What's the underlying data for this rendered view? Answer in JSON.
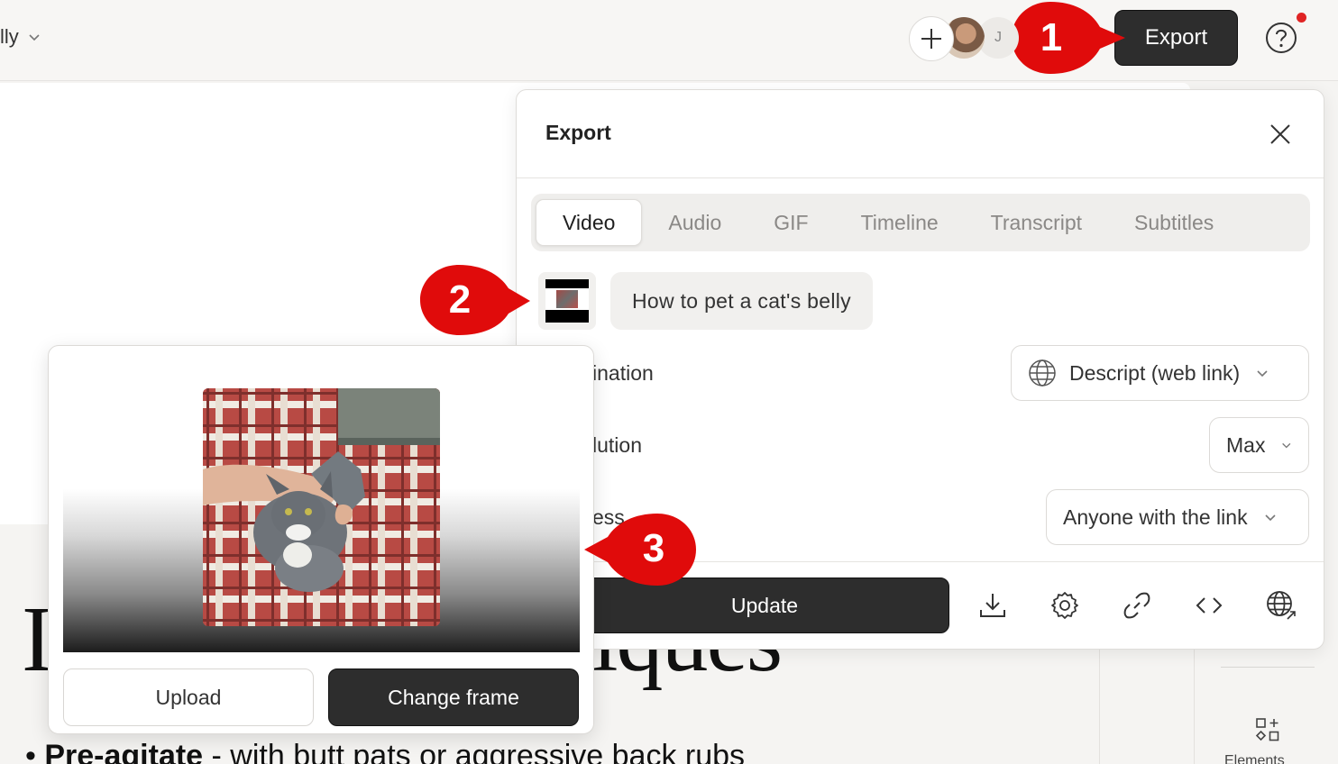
{
  "topbar": {
    "project_title": "lly",
    "avatar_initial": "J",
    "export_label": "Export"
  },
  "document": {
    "heading_visible_left": "I",
    "heading_visible_right": "iques",
    "bullet_bold": "Pre-agitate",
    "bullet_rest": " - with butt pats or aggressive back rubs",
    "rail_label": "Elements"
  },
  "export_panel": {
    "title": "Export",
    "tabs": [
      {
        "label": "Video",
        "active": true
      },
      {
        "label": "Audio",
        "active": false
      },
      {
        "label": "GIF",
        "active": false
      },
      {
        "label": "Timeline",
        "active": false
      },
      {
        "label": "Transcript",
        "active": false
      },
      {
        "label": "Subtitles",
        "active": false
      }
    ],
    "video_title": "How to pet a cat's belly",
    "rows": [
      {
        "label": "ination",
        "value": "Descript (web link)"
      },
      {
        "label": "lution",
        "value": "Max"
      },
      {
        "label": "ess",
        "value": "Anyone with the link"
      }
    ],
    "update_label": "Update"
  },
  "thumbnail_popover": {
    "upload_label": "Upload",
    "change_frame_label": "Change frame"
  },
  "callouts": {
    "one": "1",
    "two": "2",
    "three": "3"
  },
  "colors": {
    "dark_button": "#2d2d2d",
    "callout_red": "#e00b0b",
    "notification_dot": "#e02424"
  }
}
